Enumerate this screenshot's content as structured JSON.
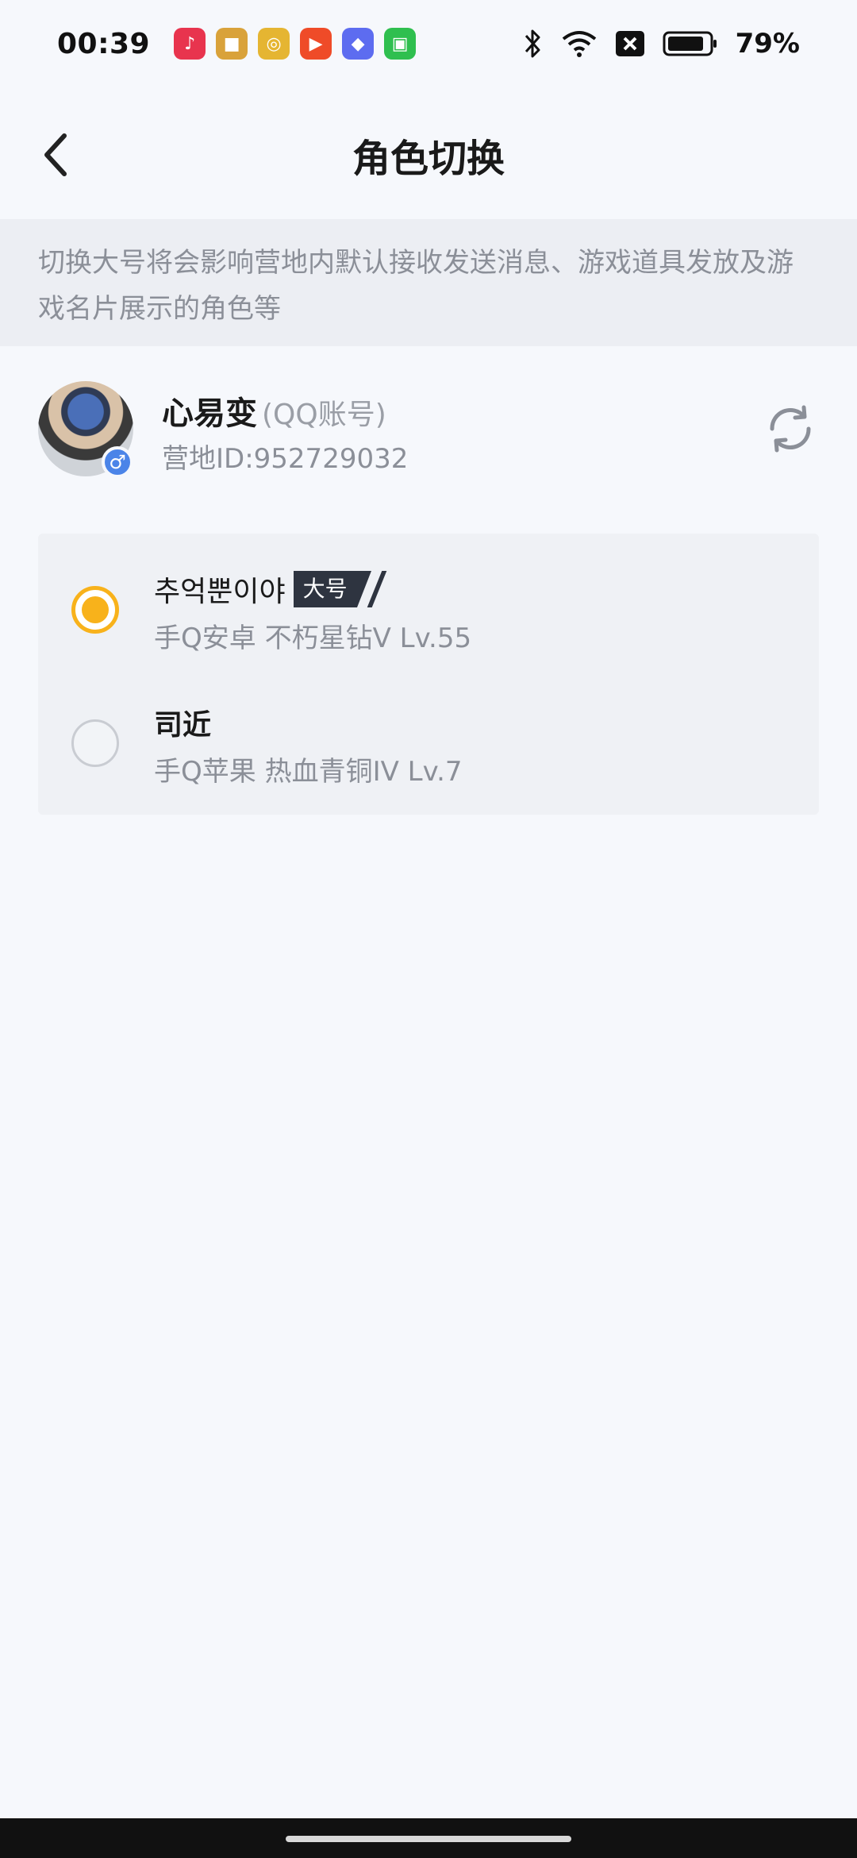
{
  "status_bar": {
    "time": "00:39",
    "battery": "79%",
    "app_icons": [
      {
        "name": "music-app-icon",
        "color": "#e8344e",
        "glyph": "♪"
      },
      {
        "name": "game-app-icon",
        "color": "#d9a23a",
        "glyph": "■"
      },
      {
        "name": "disc-app-icon",
        "color": "#e5b532",
        "glyph": "◎"
      },
      {
        "name": "video-app-icon",
        "color": "#ef4b28",
        "glyph": "▶"
      },
      {
        "name": "store-app-icon",
        "color": "#5d6cf0",
        "glyph": "◆"
      },
      {
        "name": "shop-app-icon",
        "color": "#2fbf4f",
        "glyph": "▣"
      }
    ]
  },
  "header": {
    "title": "角色切换"
  },
  "notice": {
    "text": "切换大号将会影响营地内默认接收发送消息、游戏道具发放及游戏名片展示的角色等"
  },
  "account": {
    "name": "心易变",
    "type": "(QQ账号)",
    "id": "营地ID:952729032",
    "gender_symbol": "♂"
  },
  "roles": [
    {
      "name": "추억뿐이야",
      "badge": "大号",
      "detail": "手Q安卓  不朽星钻V  Lv.55",
      "selected": true
    },
    {
      "name": "司近",
      "detail": "手Q苹果  热血青铜IV  Lv.7",
      "selected": false
    }
  ],
  "colors": {
    "accent": "#f8b21b",
    "background": "#f6f8fc"
  }
}
